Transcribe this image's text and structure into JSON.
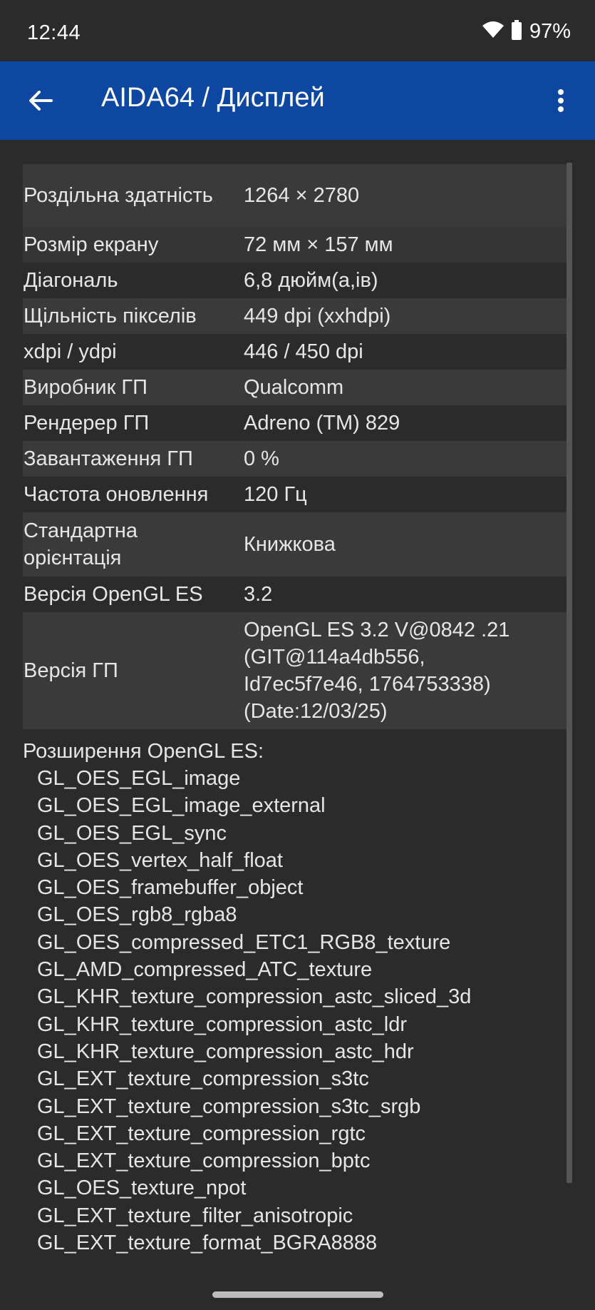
{
  "status_bar": {
    "time": "12:44",
    "battery": "97%"
  },
  "app_bar": {
    "title": "AIDA64  /  Дисплей"
  },
  "rows": [
    {
      "key": "Роздільна здатність",
      "value": "1264 × 2780"
    },
    {
      "key": "Розмір екрану",
      "value": "72 мм × 157 мм"
    },
    {
      "key": "Діагональ",
      "value": "6,8 дюйм(а,ів)"
    },
    {
      "key": "Щільність пікселів",
      "value": "449 dpi (xxhdpi)"
    },
    {
      "key": "xdpi / ydpi",
      "value": "446 / 450 dpi"
    },
    {
      "key": "Виробник ГП",
      "value": "Qualcomm"
    },
    {
      "key": "Рендерер ГП",
      "value": "Adreno (TM) 829"
    },
    {
      "key": "Завантаження ГП",
      "value": "0 %"
    },
    {
      "key": "Частота оновлення",
      "value": "120 Гц"
    },
    {
      "key": "Стандартна орієнтація",
      "value": "Книжкова"
    },
    {
      "key": "Версія OpenGL ES",
      "value": "3.2"
    },
    {
      "key": "Версія ГП",
      "value": "OpenGL ES 3.2 V@0842 .21 (GIT@114a4db556, Id7ec5f7e46, 1764753338) (Date:12/03/25)"
    }
  ],
  "extensions": {
    "title": "Розширення OpenGL ES:",
    "items": [
      "GL_OES_EGL_image",
      "GL_OES_EGL_image_external",
      "GL_OES_EGL_sync",
      "GL_OES_vertex_half_float",
      "GL_OES_framebuffer_object",
      "GL_OES_rgb8_rgba8",
      "GL_OES_compressed_ETC1_RGB8_texture",
      "GL_AMD_compressed_ATC_texture",
      "GL_KHR_texture_compression_astc_sliced_3d",
      "GL_KHR_texture_compression_astc_ldr",
      "GL_KHR_texture_compression_astc_hdr",
      "GL_EXT_texture_compression_s3tc",
      "GL_EXT_texture_compression_s3tc_srgb",
      "GL_EXT_texture_compression_rgtc",
      "GL_EXT_texture_compression_bptc",
      "GL_OES_texture_npot",
      "GL_EXT_texture_filter_anisotropic",
      "GL_EXT_texture_format_BGRA8888"
    ]
  },
  "colors": {
    "app_bar": "#0d47a1",
    "background": "#2b2b2b",
    "alt_row": "#3a3a3a"
  }
}
